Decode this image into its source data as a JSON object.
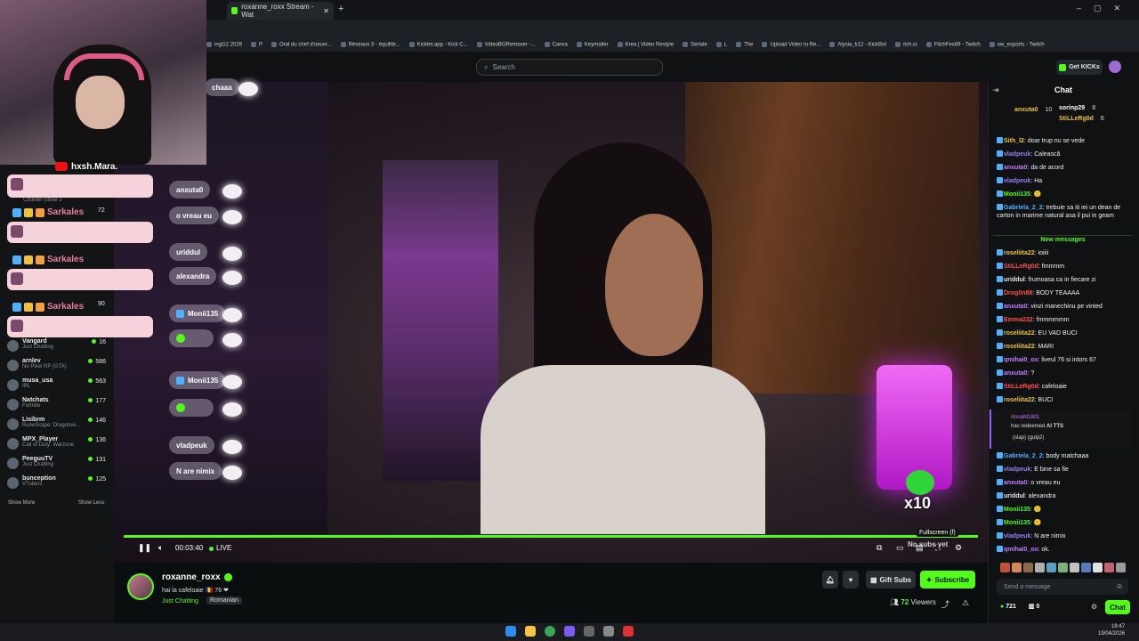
{
  "browser": {
    "tab_title": "roxanne_roxx Stream - Wat",
    "bookmarks": [
      "ingG2 2026",
      "P",
      "Oral du chef d'oeuvr...",
      "Réseaux 3 - équilibr...",
      "Kicklet.app - Kick C...",
      "VideoBGRemover -...",
      "Canva",
      "Keymailer",
      "Krea | Video Restyle",
      "Seriale",
      "L",
      "The",
      "Upload Video to Re...",
      "Alysia_k12 - KickBot",
      "itch.io",
      "FitchFex89 - Twitch",
      "ow_esports - Twitch"
    ]
  },
  "header": {
    "search_placeholder": "Search",
    "get_kicks": "Get KICKs"
  },
  "sidebar": {
    "channels": [
      {
        "name": "Vangard",
        "game": "Just Chatting",
        "viewers": "16"
      },
      {
        "name": "arnlev",
        "game": "No Pixel RP (GTA)",
        "viewers": "586"
      },
      {
        "name": "musa_usa",
        "game": "IRL",
        "viewers": "563"
      },
      {
        "name": "Natchats",
        "game": "Fortnite",
        "viewers": "177"
      },
      {
        "name": "Lisibrm",
        "game": "RuneScape: Dragonwi...",
        "viewers": "146"
      },
      {
        "name": "MPX_Player",
        "game": "Call of Duty: Warzone",
        "viewers": "136"
      },
      {
        "name": "PeeguuTV",
        "game": "Just Chatting",
        "viewers": "131"
      },
      {
        "name": "bunception",
        "game": "VTubers",
        "viewers": "125"
      }
    ],
    "show_more": "Show More",
    "show_less": "Show Less",
    "hidden_game": "Counter-Strike 2",
    "hidden_count_1": "72",
    "hidden_count_2": "90"
  },
  "webcam": {
    "name": "hxsh.Mara.",
    "overlay_names": [
      "Sarkales",
      "Sarkales",
      "Sarkales"
    ]
  },
  "video_chat_overlay": [
    {
      "text": "chaaa"
    },
    {
      "text": "anxuta0"
    },
    {
      "text": "o vreau eu"
    },
    {
      "text": "uriddul"
    },
    {
      "text": "alexandra"
    },
    {
      "text": "Monii135"
    },
    {
      "text": "Monii135"
    },
    {
      "text": "vladpeuk"
    },
    {
      "text": "N are nimix"
    }
  ],
  "video": {
    "x10": "x10",
    "time": "00:03:40",
    "live": "LIVE",
    "tooltip": "Fullscreen (f)",
    "overlay_text": "No subs yet",
    "progress": 1.0
  },
  "streamer": {
    "name": "roxanne_roxx",
    "title": "hai la cafeloaie 🇷🇴 76 ❤",
    "category": "Just Chatting",
    "language": "Romanian",
    "gift_subs": "Gift Subs",
    "subscribe": "Subscribe",
    "viewers": "72",
    "viewers_label": "Viewers"
  },
  "chat": {
    "title": "Chat",
    "pinned": [
      {
        "name": "anxuta0",
        "count": "10"
      },
      {
        "name": "sorinp29",
        "count": "8"
      },
      {
        "name": "StiLLeRg0d",
        "count": "6"
      }
    ],
    "messages_top": [
      {
        "user": "Sith_l2",
        "text": "doar trup nu se vede",
        "color": "#f0c23c"
      },
      {
        "user": "vladpeuk",
        "text": "Calească",
        "color": "#9b7df5"
      },
      {
        "user": "anxuta0",
        "text": "da de acord",
        "color": "#c77dff"
      },
      {
        "user": "vladpeuk",
        "text": "Ha",
        "color": "#9b7df5"
      },
      {
        "user": "Monii135",
        "text": "🙂",
        "color": "#53fc18"
      },
      {
        "user": "Gabriela_2_2",
        "text": "trebuie sa iti iei un dean de carton in marime natural asa il pui in geam",
        "color": "#4fb0ff"
      }
    ],
    "new_messages": "New messages",
    "messages": [
      {
        "user": "roseliita22",
        "text": "ioiiii",
        "color": "#f0c23c"
      },
      {
        "user": "StiLLeRg0d",
        "text": "fmmmm",
        "color": "#ff4f4f"
      },
      {
        "user": "uriddul",
        "text": "frumoasa ca in fiecare zi",
        "color": "#e6e6e6"
      },
      {
        "user": "Drog0n88",
        "text": "BODY TEAAAA",
        "color": "#ff4f4f"
      },
      {
        "user": "anxuta0",
        "text": "vinzi manechinu pe vinted",
        "color": "#c77dff"
      },
      {
        "user": "Emma232",
        "text": "fmmmmmm",
        "color": "#ff4f4f"
      },
      {
        "user": "roseliita22",
        "text": "EU VAD BUCI",
        "color": "#f0c23c"
      },
      {
        "user": "roseliita22",
        "text": "MARI",
        "color": "#f0c23c"
      },
      {
        "user": "qmihai0_ox",
        "text": "liveul 76 si intors 67",
        "color": "#c77dff"
      },
      {
        "user": "anxuta0",
        "text": "?",
        "color": "#c77dff"
      },
      {
        "user": "StiLLeRg0d",
        "text": "cafeloaie",
        "color": "#ff4f4f"
      },
      {
        "user": "roseliita22",
        "text": "BUCI",
        "color": "#f0c23c"
      }
    ],
    "redeem": {
      "user": "AnnaM1801",
      "action": "has redeemed",
      "reward": "AI TTS",
      "msg": "(slap) (gulp2)"
    },
    "messages_bottom": [
      {
        "user": "Gabriela_2_2",
        "text": "body matchaaa",
        "color": "#4fb0ff"
      },
      {
        "user": "vladpeuk",
        "text": "E bine sa fie",
        "color": "#9b7df5"
      },
      {
        "user": "anxuta0",
        "text": "o vreau eu",
        "color": "#c77dff"
      },
      {
        "user": "uriddul",
        "text": "alexandra",
        "color": "#e6e6e6"
      },
      {
        "user": "Monii135",
        "text": "🙂",
        "color": "#53fc18"
      },
      {
        "user": "Monii135",
        "text": "🙂",
        "color": "#53fc18"
      },
      {
        "user": "vladpeuk",
        "text": "N are nimix",
        "color": "#9b7df5"
      },
      {
        "user": "qmihai0_ox",
        "text": "ok.",
        "color": "#c77dff"
      }
    ],
    "input_placeholder": "Send a message",
    "points": "721",
    "count2": "0",
    "chat_button": "Chat"
  },
  "taskbar": {
    "time": "18:47",
    "date": "19/04/2026"
  },
  "colors": {
    "accent": "#53fc18",
    "bg": "#0b0e0f",
    "pink": "#f6d3db"
  }
}
